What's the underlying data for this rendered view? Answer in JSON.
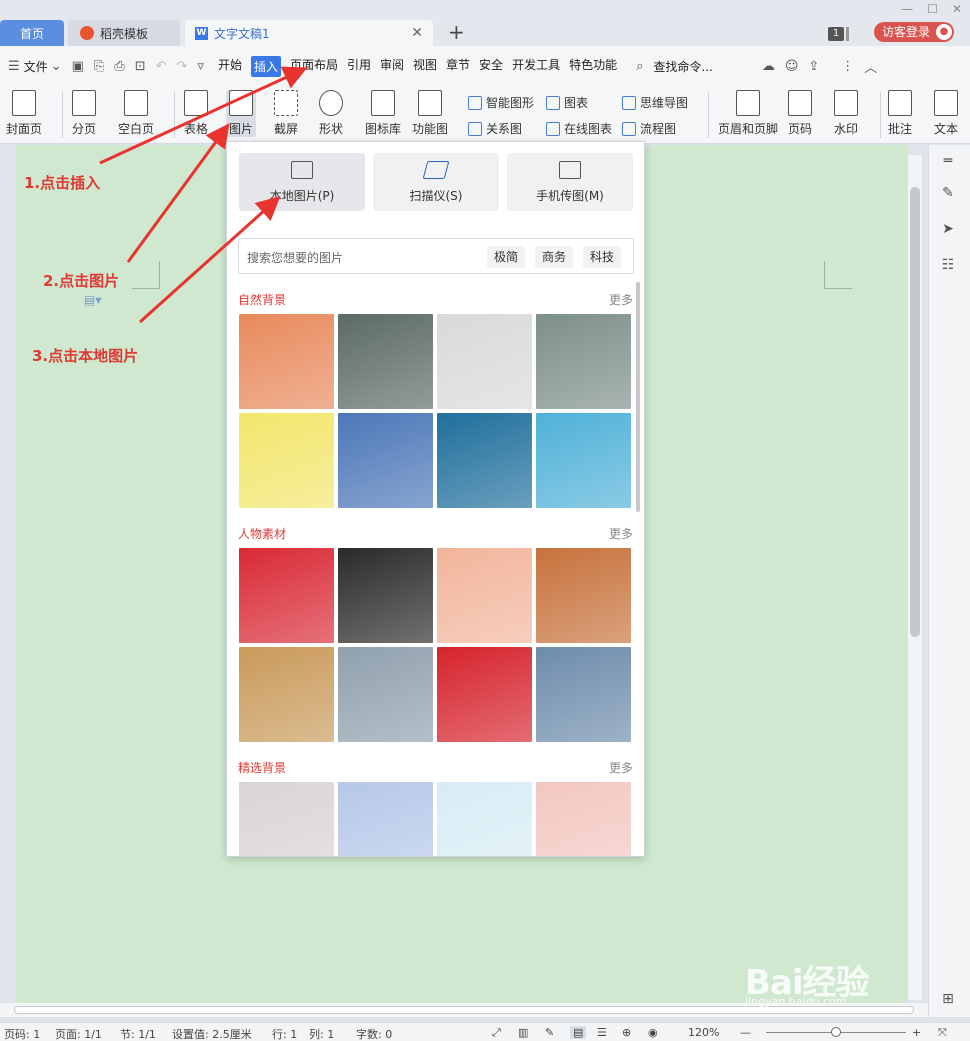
{
  "tabs": {
    "home": "首页",
    "template": "稻壳模板",
    "document": "文字文稿1"
  },
  "login": "访客登录",
  "badge": "1",
  "menubar": {
    "file": "文件",
    "items": [
      "开始",
      "插入",
      "页面布局",
      "引用",
      "审阅",
      "视图",
      "章节",
      "安全",
      "开发工具",
      "特色功能"
    ],
    "active": "插入",
    "search": "查找命令..."
  },
  "ribbon": {
    "cover": "封面页",
    "page_break": "分页",
    "blank": "空白页",
    "table": "表格",
    "picture": "图片",
    "screenshot": "截屏",
    "shape": "形状",
    "icon_lib": "图标库",
    "func_chart": "功能图",
    "smart_shape": "智能图形",
    "chart": "图表",
    "mind_map": "思维导图",
    "relation": "关系图",
    "online_chart": "在线图表",
    "flowchart": "流程图",
    "header_footer": "页眉和页脚",
    "page_num": "页码",
    "watermark": "水印",
    "comment": "批注",
    "text": "文本"
  },
  "annotations": {
    "step1": "1.点击插入",
    "step2": "2.点击图片",
    "step3": "3.点击本地图片"
  },
  "popup": {
    "local": "本地图片(P)",
    "scanner": "扫描仪(S)",
    "phone": "手机传图(M)",
    "search_placeholder": "搜索您想要的图片",
    "tags": [
      "极简",
      "商务",
      "科技"
    ],
    "more": "更多",
    "sections": [
      {
        "title": "自然背景",
        "thumbs": [
          "#e88a5c",
          "#5b6b63",
          "#d9d9d9",
          "#7d8f8a",
          "#f2e66b",
          "#4c77b8",
          "#1f6f9c",
          "#4fb1d8"
        ]
      },
      {
        "title": "人物素材",
        "thumbs": [
          "#d92a35",
          "#2a2a2a",
          "#f2b59b",
          "#c7723c",
          "#c99a5a",
          "#8fa0ad",
          "#d6232c",
          "#6d8cab"
        ]
      },
      {
        "title": "精选背景",
        "thumbs": [
          "#d9d4d6",
          "#b6c8e8",
          "#d8ecf5",
          "#f3c7c1"
        ]
      }
    ]
  },
  "status": {
    "page": "页码: 1",
    "pages": "页面: 1/1",
    "section": "节: 1/1",
    "setting": "设置值: 2.5厘米",
    "row": "行: 1",
    "col": "列: 1",
    "words": "字数: 0",
    "zoom": "120%",
    "zoom_level": 0.5
  },
  "watermark": {
    "brand": "Bai经验",
    "url": "jingyan.baidu.com"
  }
}
